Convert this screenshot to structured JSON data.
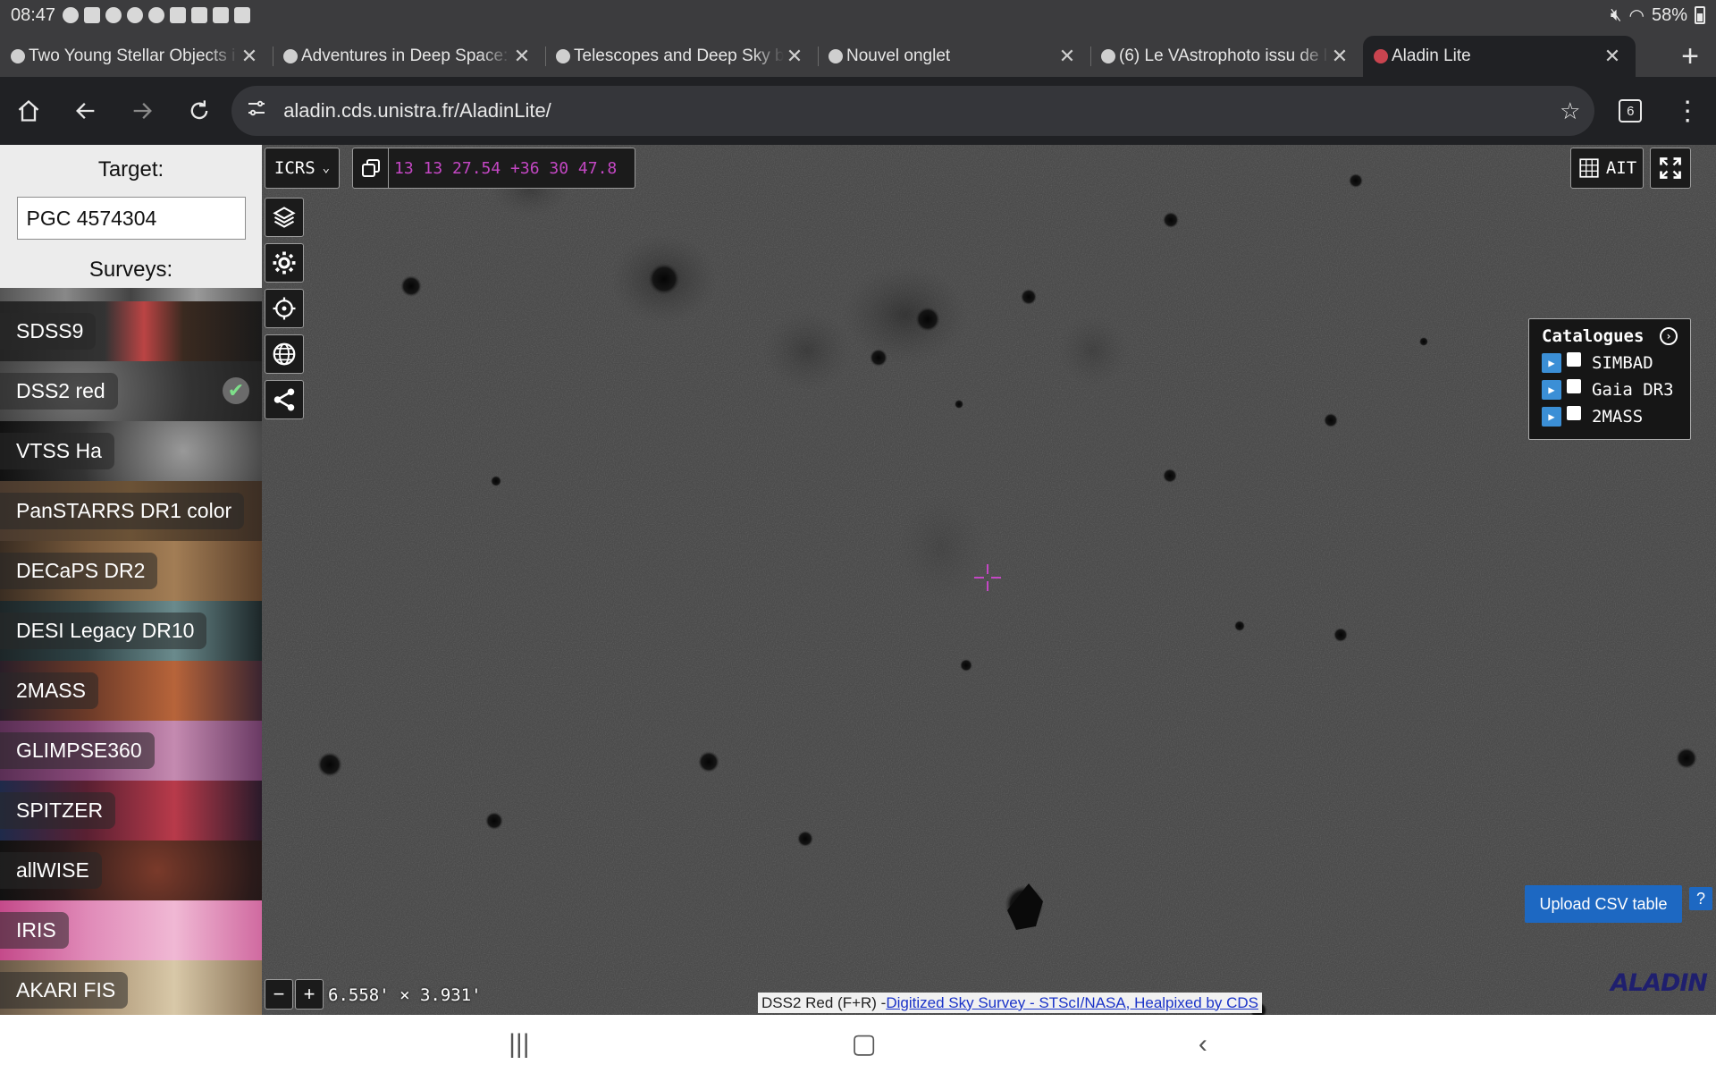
{
  "status_bar": {
    "time": "08:47",
    "battery": "58%"
  },
  "tabs": [
    {
      "title": "Two Young Stellar Objects i",
      "close": "✕"
    },
    {
      "title": "Adventures in Deep Space:",
      "close": "✕"
    },
    {
      "title": "Telescopes and Deep Sky b",
      "close": "✕"
    },
    {
      "title": "Nouvel onglet",
      "close": "✕"
    },
    {
      "title": "(6) Le VAstrophoto issu de l",
      "close": "✕"
    },
    {
      "title": "Aladin Lite",
      "close": "✕"
    }
  ],
  "toolbar": {
    "url": "aladin.cds.unistra.fr/AladinLite/",
    "tab_count": "6"
  },
  "left_panel": {
    "target_label": "Target:",
    "target_value": "PGC 4574304",
    "surveys_label": "Surveys:",
    "surveys": [
      {
        "label": "SDSS9",
        "selected": false
      },
      {
        "label": "DSS2 red",
        "selected": true
      },
      {
        "label": "VTSS Ha",
        "selected": false
      },
      {
        "label": "PanSTARRS DR1 color",
        "selected": false
      },
      {
        "label": "DECaPS DR2",
        "selected": false
      },
      {
        "label": "DESI Legacy DR10",
        "selected": false
      },
      {
        "label": "2MASS",
        "selected": false
      },
      {
        "label": "GLIMPSE360",
        "selected": false
      },
      {
        "label": "SPITZER",
        "selected": false
      },
      {
        "label": "allWISE",
        "selected": false
      },
      {
        "label": "IRIS",
        "selected": false
      },
      {
        "label": "AKARI FIS",
        "selected": false
      }
    ]
  },
  "viewer": {
    "frame": "ICRS",
    "coordinates": "13 13 27.54 +36 30 47.8",
    "projection": "AIT",
    "fov": "6.558' × 3.931'",
    "zoom_minus": "−",
    "zoom_plus": "+",
    "catalogues_title": "Catalogues",
    "catalogues": [
      {
        "name": "SIMBAD",
        "checked": false
      },
      {
        "name": "Gaia DR3",
        "checked": false
      },
      {
        "name": "2MASS",
        "checked": false
      }
    ],
    "upload_label": "Upload CSV table",
    "help_label": "?",
    "attribution_prefix": "DSS2 Red (F+R) - ",
    "attribution_link": "Digitized Sky Survey - STScI/NASA, Healpixed by CDS",
    "logo_text": "ALADIN"
  },
  "colors": {
    "accent_magenta": "#c447c4",
    "upload_blue": "#1d68c2"
  }
}
